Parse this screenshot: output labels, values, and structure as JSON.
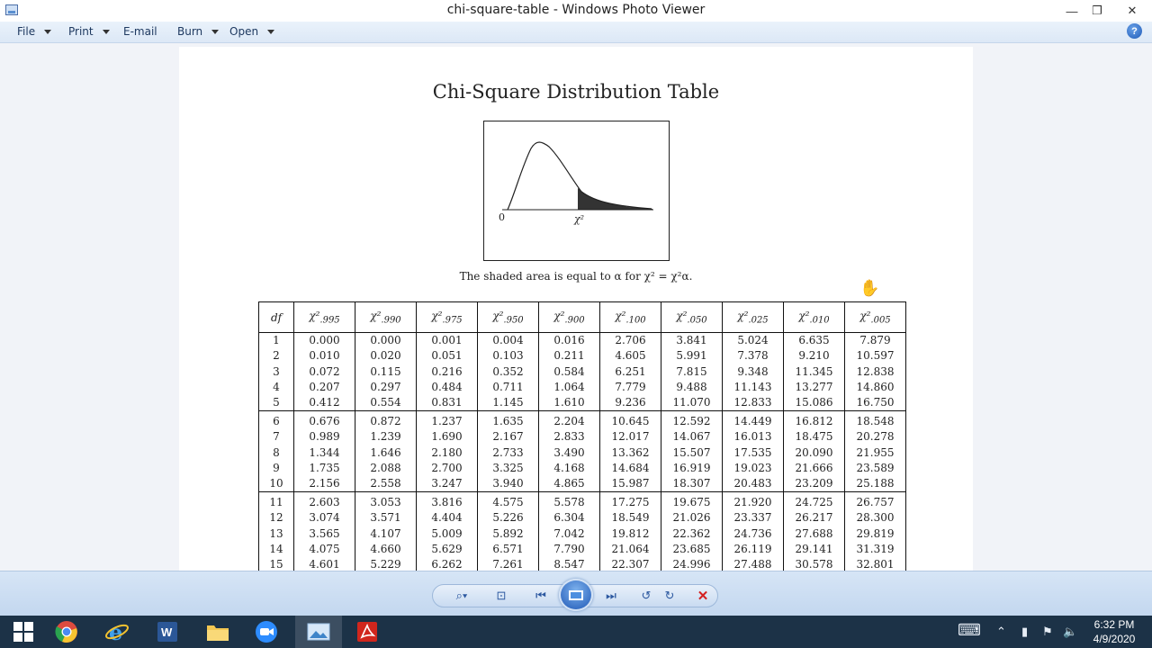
{
  "window": {
    "title": "chi-square-table - Windows Photo Viewer",
    "minimize_glyph": "—",
    "maximize_glyph": "❐",
    "close_glyph": "✕"
  },
  "menu": {
    "file": "File",
    "print": "Print",
    "email": "E-mail",
    "burn": "Burn",
    "open": "Open",
    "help_glyph": "?"
  },
  "document": {
    "title": "Chi-Square Distribution Table",
    "figure": {
      "origin_label": "0",
      "chi_label": "χ²"
    },
    "caption": "The shaded area is equal to α for χ² = χ²α.",
    "table": {
      "header_df": "df",
      "columns": [
        ".995",
        ".990",
        ".975",
        ".950",
        ".900",
        ".100",
        ".050",
        ".025",
        ".010",
        ".005"
      ],
      "rows": [
        [
          "1",
          "0.000",
          "0.000",
          "0.001",
          "0.004",
          "0.016",
          "2.706",
          "3.841",
          "5.024",
          "6.635",
          "7.879"
        ],
        [
          "2",
          "0.010",
          "0.020",
          "0.051",
          "0.103",
          "0.211",
          "4.605",
          "5.991",
          "7.378",
          "9.210",
          "10.597"
        ],
        [
          "3",
          "0.072",
          "0.115",
          "0.216",
          "0.352",
          "0.584",
          "6.251",
          "7.815",
          "9.348",
          "11.345",
          "12.838"
        ],
        [
          "4",
          "0.207",
          "0.297",
          "0.484",
          "0.711",
          "1.064",
          "7.779",
          "9.488",
          "11.143",
          "13.277",
          "14.860"
        ],
        [
          "5",
          "0.412",
          "0.554",
          "0.831",
          "1.145",
          "1.610",
          "9.236",
          "11.070",
          "12.833",
          "15.086",
          "16.750"
        ],
        [
          "6",
          "0.676",
          "0.872",
          "1.237",
          "1.635",
          "2.204",
          "10.645",
          "12.592",
          "14.449",
          "16.812",
          "18.548"
        ],
        [
          "7",
          "0.989",
          "1.239",
          "1.690",
          "2.167",
          "2.833",
          "12.017",
          "14.067",
          "16.013",
          "18.475",
          "20.278"
        ],
        [
          "8",
          "1.344",
          "1.646",
          "2.180",
          "2.733",
          "3.490",
          "13.362",
          "15.507",
          "17.535",
          "20.090",
          "21.955"
        ],
        [
          "9",
          "1.735",
          "2.088",
          "2.700",
          "3.325",
          "4.168",
          "14.684",
          "16.919",
          "19.023",
          "21.666",
          "23.589"
        ],
        [
          "10",
          "2.156",
          "2.558",
          "3.247",
          "3.940",
          "4.865",
          "15.987",
          "18.307",
          "20.483",
          "23.209",
          "25.188"
        ],
        [
          "11",
          "2.603",
          "3.053",
          "3.816",
          "4.575",
          "5.578",
          "17.275",
          "19.675",
          "21.920",
          "24.725",
          "26.757"
        ],
        [
          "12",
          "3.074",
          "3.571",
          "4.404",
          "5.226",
          "6.304",
          "18.549",
          "21.026",
          "23.337",
          "26.217",
          "28.300"
        ],
        [
          "13",
          "3.565",
          "4.107",
          "5.009",
          "5.892",
          "7.042",
          "19.812",
          "22.362",
          "24.736",
          "27.688",
          "29.819"
        ],
        [
          "14",
          "4.075",
          "4.660",
          "5.629",
          "6.571",
          "7.790",
          "21.064",
          "23.685",
          "26.119",
          "29.141",
          "31.319"
        ],
        [
          "15",
          "4.601",
          "5.229",
          "6.262",
          "7.261",
          "8.547",
          "22.307",
          "24.996",
          "27.488",
          "30.578",
          "32.801"
        ]
      ]
    }
  },
  "navbar": {
    "zoom_glyph": "⌕▾",
    "fit_glyph": "⊡",
    "prev_glyph": "⏮",
    "next_glyph": "⏭",
    "rotate_ccw_glyph": "↺",
    "rotate_cw_glyph": "↻",
    "delete_glyph": "✕"
  },
  "taskbar": {
    "time": "6:32 PM",
    "date": "4/9/2020",
    "keyboard_glyph": "⌨",
    "chevron_glyph": "⌃",
    "power_glyph": "▮",
    "flag_glyph": "⚑",
    "volume_glyph": "🔈"
  },
  "colors": {
    "taskbar_bg": "#1c3247",
    "navbar_bg": "#c3d7ef",
    "viewer_bg": "#f1f3f8"
  }
}
